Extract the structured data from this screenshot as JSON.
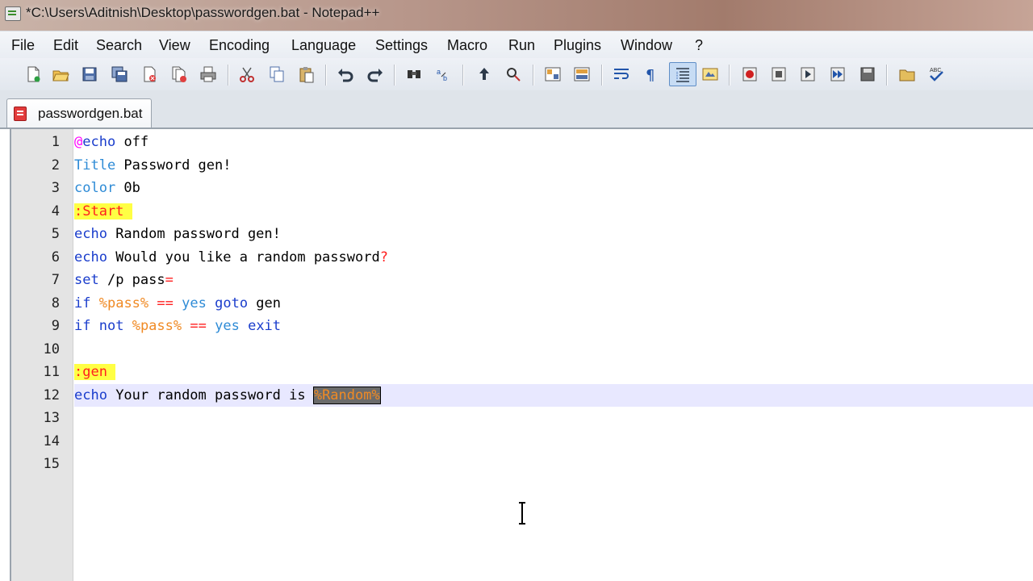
{
  "window": {
    "title": "*C:\\Users\\Aditnish\\Desktop\\passwordgen.bat - Notepad++"
  },
  "menu": [
    "File",
    "Edit",
    "Search",
    "View",
    "Encoding",
    "Language",
    "Settings",
    "Macro",
    "Run",
    "Plugins",
    "Window",
    "?"
  ],
  "toolbar": {
    "icons": [
      "new-file-icon",
      "open-file-icon",
      "save-icon",
      "save-all-icon",
      "close-icon",
      "close-all-icon",
      "print-icon",
      "cut-icon",
      "copy-icon",
      "paste-icon",
      "undo-icon",
      "redo-icon",
      "find-icon",
      "replace-icon",
      "zoom-in-icon",
      "zoom-out-icon",
      "sync-vertical-icon",
      "sync-horizontal-icon",
      "word-wrap-icon",
      "show-all-chars-icon",
      "indent-guide-icon",
      "user-language-icon",
      "record-macro-icon",
      "stop-record-icon",
      "play-macro-icon",
      "run-macro-multiple-icon",
      "save-macro-icon",
      "folder-icon",
      "spell-check-icon"
    ],
    "active_icon": "indent-guide-icon"
  },
  "tabs": [
    {
      "label": "passwordgen.bat",
      "active": true,
      "modified": true
    }
  ],
  "editor": {
    "line_numbers": [
      "1",
      "2",
      "3",
      "4",
      "5",
      "6",
      "7",
      "8",
      "9",
      "10",
      "11",
      "12",
      "13",
      "14",
      "15"
    ],
    "lines": [
      [
        {
          "t": "@",
          "c": "at"
        },
        {
          "t": "echo",
          "c": "cmd"
        },
        {
          "t": " off",
          "c": "plain"
        }
      ],
      [
        {
          "t": "Title",
          "c": "word"
        },
        {
          "t": " Password gen!",
          "c": "plain"
        }
      ],
      [
        {
          "t": "color",
          "c": "word"
        },
        {
          "t": " 0b",
          "c": "plain"
        }
      ],
      [
        {
          "t": ":Start ",
          "c": "label-hl"
        }
      ],
      [
        {
          "t": "echo",
          "c": "cmd"
        },
        {
          "t": " Random password gen!",
          "c": "plain"
        }
      ],
      [
        {
          "t": "echo",
          "c": "cmd"
        },
        {
          "t": " Would you like a random password",
          "c": "plain"
        },
        {
          "t": "?",
          "c": "op"
        }
      ],
      [
        {
          "t": "set",
          "c": "cmd"
        },
        {
          "t": " /p pass",
          "c": "plain"
        },
        {
          "t": "=",
          "c": "op"
        }
      ],
      [
        {
          "t": "if",
          "c": "cmd"
        },
        {
          "t": " ",
          "c": "plain"
        },
        {
          "t": "%pass%",
          "c": "var"
        },
        {
          "t": " ",
          "c": "plain"
        },
        {
          "t": "==",
          "c": "op"
        },
        {
          "t": " ",
          "c": "plain"
        },
        {
          "t": "yes",
          "c": "word"
        },
        {
          "t": " ",
          "c": "plain"
        },
        {
          "t": "goto",
          "c": "cmd"
        },
        {
          "t": " gen",
          "c": "plain"
        }
      ],
      [
        {
          "t": "if",
          "c": "cmd"
        },
        {
          "t": " ",
          "c": "plain"
        },
        {
          "t": "not",
          "c": "cmd"
        },
        {
          "t": " ",
          "c": "plain"
        },
        {
          "t": "%pass%",
          "c": "var"
        },
        {
          "t": " ",
          "c": "plain"
        },
        {
          "t": "==",
          "c": "op"
        },
        {
          "t": " ",
          "c": "plain"
        },
        {
          "t": "yes",
          "c": "word"
        },
        {
          "t": " ",
          "c": "plain"
        },
        {
          "t": "exit",
          "c": "cmd"
        }
      ],
      [],
      [
        {
          "t": ":gen ",
          "c": "label-hl"
        }
      ],
      [
        {
          "t": "echo",
          "c": "cmd"
        },
        {
          "t": " Your random password is ",
          "c": "plain"
        },
        {
          "t": "%Random%",
          "c": "sel"
        }
      ],
      [],
      [],
      []
    ],
    "current_line": 12
  },
  "colors": {
    "label_highlight": "#ffff44",
    "keyword": "#1a3dcc",
    "variable": "#f08a24",
    "operator": "#ff2020",
    "gutter": "#e4e4e4"
  }
}
